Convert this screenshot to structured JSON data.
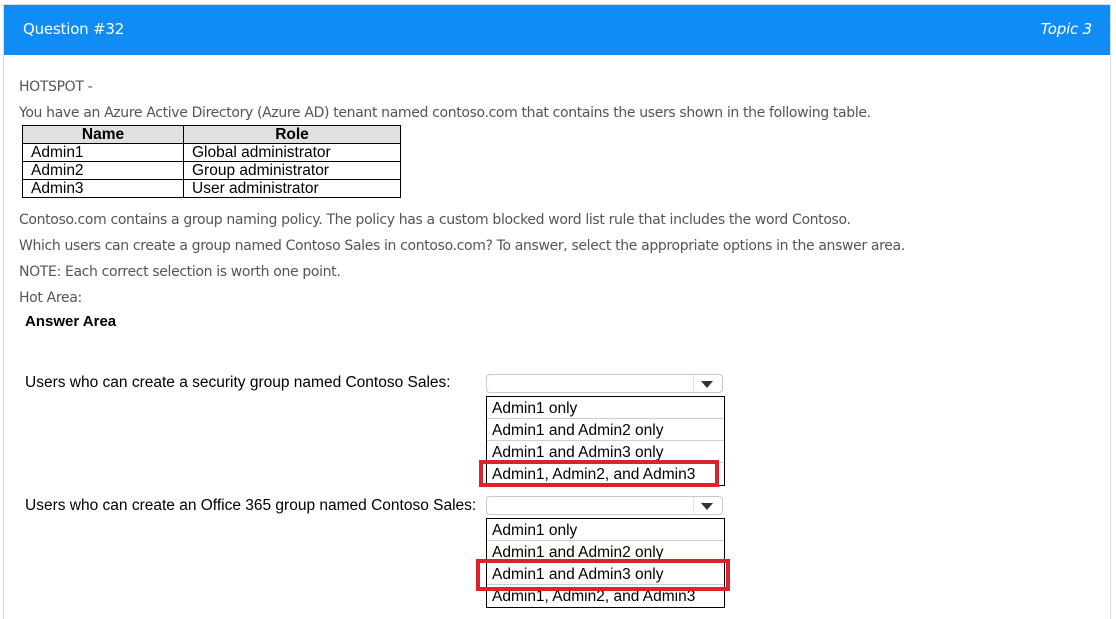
{
  "header": {
    "title": "Question #32",
    "topic": "Topic 3",
    "color": "#0f8cf6"
  },
  "body": {
    "type_label": "HOTSPOT -",
    "intro": "You have an Azure Active Directory (Azure AD) tenant named contoso.com that contains the users shown in the following table.",
    "policy": "Contoso.com contains a group naming policy. The policy has a custom blocked word list rule that includes the word Contoso.",
    "question": "Which users can create a group named Contoso Sales in contoso.com? To answer, select the appropriate options in the answer area.",
    "note": "NOTE: Each correct selection is worth one point.",
    "hot_area": "Hot Area:"
  },
  "table": {
    "headers": [
      "Name",
      "Role"
    ],
    "rows": [
      [
        "Admin1",
        "Global administrator"
      ],
      [
        "Admin2",
        "Group administrator"
      ],
      [
        "Admin3",
        "User administrator"
      ]
    ]
  },
  "answer_area": {
    "title": "Answer Area",
    "questions": [
      {
        "label": "Users who can create a security group named Contoso Sales:",
        "selected": "",
        "options": [
          "Admin1 only",
          "Admin1 and Admin2 only",
          "Admin1 and Admin3 only",
          "Admin1, Admin2, and Admin3"
        ],
        "highlighted": "Admin1, Admin2, and Admin3"
      },
      {
        "label": "Users who can create an Office 365 group named Contoso Sales:",
        "selected": "",
        "options": [
          "Admin1 only",
          "Admin1 and Admin2 only",
          "Admin1 and Admin3 only",
          "Admin1, Admin2, and Admin3"
        ],
        "highlighted": "Admin1 and Admin3 only"
      }
    ],
    "highlight_color": "#e0202a"
  }
}
